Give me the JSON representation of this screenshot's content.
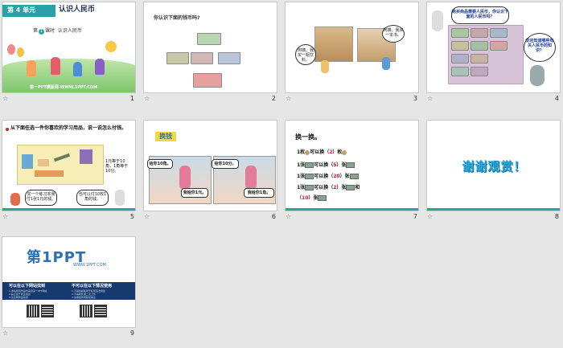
{
  "slides": [
    {
      "number": "1",
      "unit": "第 4 单元",
      "title": "认识人民币",
      "lesson_prefix": "第",
      "lesson_no": "1",
      "lesson_suffix": "课时",
      "lesson_title": "认识人民币",
      "watermark": "第一PPT模板网-WWW.1PPT.COM"
    },
    {
      "number": "2",
      "question": "你认识下面的钱币吗?"
    },
    {
      "number": "3",
      "bubble_left": "阿姨，我买一瓶饮料。",
      "bubble_right": "阿姨，我买一本书。"
    },
    {
      "number": "4",
      "bubble_top": "购买商品需要人民币，你认识下面的人民币吗？",
      "bubble_right": "你还知道哪些有关人民币的知识？"
    },
    {
      "number": "5",
      "instruction": "从下面任选一件你喜欢的学习用品，说一说怎么付钱。",
      "price_note": "1元等于10角，1角等于10分。",
      "bubble_left": "买一个练习本我付1张1元的钱。",
      "bubble_right": "也可以付10枚1角的钱。"
    },
    {
      "number": "6",
      "title": "换钱",
      "bubble_left": "给你10角。",
      "bubble_left2": "我给你1元。",
      "bubble_right": "给你10分。",
      "bubble_right2": "我给你1角。"
    },
    {
      "number": "7",
      "title": "换一换。",
      "rows": [
        {
          "prefix": "1枚",
          "verb": "可以换（",
          "answer": "2",
          "unit": "）枚"
        },
        {
          "prefix": "1张",
          "verb": "可以换（",
          "answer": "5",
          "unit": "）张"
        },
        {
          "prefix": "1张",
          "verb": "可以换（",
          "answer": "20",
          "unit": "）张"
        },
        {
          "prefix": "1张",
          "verb": "可以换（",
          "answer": "2",
          "unit": "）张",
          "tail": "和"
        },
        {
          "prefix": "（",
          "answer": "10",
          "unit": "）张"
        }
      ]
    },
    {
      "number": "8",
      "thanks": "谢谢观赏！"
    },
    {
      "number": "9",
      "logo_main": "第1PPT",
      "logo_sub": "WWW.1PPT.COM",
      "col_left_title": "可以在以下网站找到",
      "col_right_title": "不可以在以下情况使用",
      "col_left_lines": [
        "1.本站所有作品均来自第一PPT网站",
        "2.禁止用于商业用途",
        "3.请注明作品来源"
      ],
      "col_right_lines": [
        "1.不得将模板用于任何违法用途",
        "2.不得转售或二次上传",
        "3.请保留作者版权信息"
      ]
    }
  ],
  "star_glyph": "☆",
  "colors": {
    "teal": "#2aa1a6",
    "blue": "#2d6fb6",
    "red": "#d12020"
  }
}
